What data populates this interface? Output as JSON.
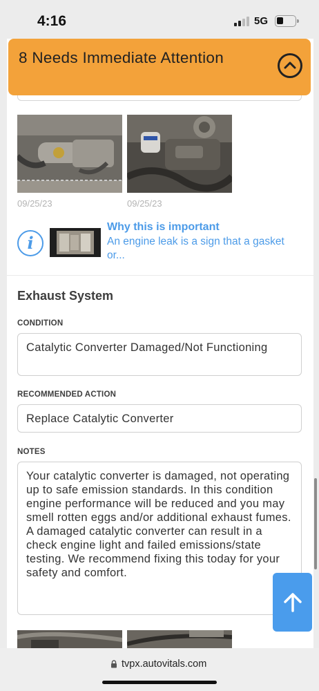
{
  "status_bar": {
    "time": "4:16",
    "network": "5G",
    "signal_icon": "cellular-signal-icon",
    "battery_icon": "battery-low-icon"
  },
  "header": {
    "title": "8 Needs Immediate Attention",
    "collapse_icon": "chevron-up-circle-icon",
    "color": "#f3a23a"
  },
  "photos_top": [
    {
      "date": "09/25/23"
    },
    {
      "date": "09/25/23"
    }
  ],
  "info": {
    "icon": "info-icon",
    "title": "Why this is important",
    "text": "An engine leak is a sign that a gasket or...",
    "color": "#4c9be8"
  },
  "section": {
    "title": "Exhaust System",
    "condition_label": "CONDITION",
    "condition_value": "Catalytic Converter Damaged/Not Functioning",
    "action_label": "RECOMMENDED ACTION",
    "action_value": "Replace Catalytic Converter",
    "notes_label": "NOTES",
    "notes_value": "Your catalytic converter is damaged, not operating up to safe emission standards. In this condition engine performance will be reduced and you may smell rotten eggs and/or additional exhaust fumes. A damaged catalytic converter can result in a check engine light and failed emissions/state testing. We recommend fixing this today for your safety and comfort."
  },
  "scroll_top": {
    "icon": "arrow-up-icon",
    "color": "#4a9cec"
  },
  "browser": {
    "url": "tvpx.autovitals.com",
    "lock_icon": "lock-icon"
  }
}
